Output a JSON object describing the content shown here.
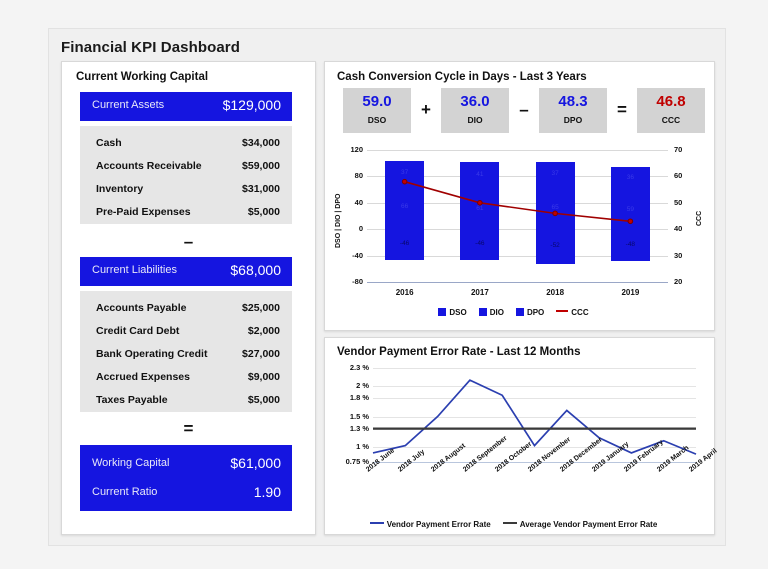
{
  "dashboard": {
    "title": "Financial KPI Dashboard"
  },
  "working_capital": {
    "panel_title": "Current Working Capital",
    "assets_header": {
      "label": "Current Assets",
      "value": "$129,000"
    },
    "assets_rows": [
      {
        "name": "Cash",
        "value": "$34,000"
      },
      {
        "name": "Accounts Receivable",
        "value": "$59,000"
      },
      {
        "name": "Inventory",
        "value": "$31,000"
      },
      {
        "name": "Pre-Paid Expenses",
        "value": "$5,000"
      }
    ],
    "operator_minus": "–",
    "liabilities_header": {
      "label": "Current Liabilities",
      "value": "$68,000"
    },
    "liabilities_rows": [
      {
        "name": "Accounts Payable",
        "value": "$25,000"
      },
      {
        "name": "Credit Card Debt",
        "value": "$2,000"
      },
      {
        "name": "Bank Operating Credit",
        "value": "$27,000"
      },
      {
        "name": "Accrued Expenses",
        "value": "$9,000"
      },
      {
        "name": "Taxes Payable",
        "value": "$5,000"
      }
    ],
    "operator_equals": "=",
    "result_rows": [
      {
        "name": "Working Capital",
        "value": "$61,000"
      },
      {
        "name": "Current Ratio",
        "value": "1.90"
      }
    ]
  },
  "ccc": {
    "panel_title": "Cash Conversion Cycle in Days - Last 3 Years",
    "kpis": [
      {
        "value": "59.0",
        "caption": "DSO",
        "color": "#1515e0"
      },
      {
        "value": "36.0",
        "caption": "DIO",
        "color": "#1515e0"
      },
      {
        "value": "48.3",
        "caption": "DPO",
        "color": "#1515e0"
      },
      {
        "value": "46.8",
        "caption": "CCC",
        "color": "#c00000"
      }
    ],
    "operators": {
      "plus": "+",
      "minus": "–",
      "equals": "="
    },
    "chart_data": {
      "type": "bar",
      "title": "Cash Conversion Cycle in Days - Last 3 Years",
      "categories": [
        "2016",
        "2017",
        "2018",
        "2019"
      ],
      "series": [
        {
          "name": "DSO",
          "values": [
            66,
            61,
            65,
            59
          ]
        },
        {
          "name": "DIO",
          "values": [
            37,
            41,
            37,
            36
          ]
        },
        {
          "name": "DPO",
          "values": [
            -46,
            -46,
            -52,
            -48
          ]
        },
        {
          "name": "CCC",
          "values": [
            58,
            50,
            46,
            43
          ],
          "axis": "right",
          "type": "line",
          "color": "#a00000"
        }
      ],
      "ylabel": "DSO | DIO | DPO",
      "ylim": [
        -80,
        120
      ],
      "yticks": [
        "-80",
        "-40",
        "0",
        "40",
        "80",
        "120"
      ],
      "y2label": "CCC",
      "y2lim": [
        20,
        70
      ],
      "y2ticks": [
        "20",
        "30",
        "40",
        "50",
        "60",
        "70"
      ],
      "xlabel": "",
      "grid": true,
      "legend": [
        "DSO",
        "DIO",
        "DPO",
        "CCC"
      ],
      "legend_position": "bottom"
    }
  },
  "vendor": {
    "panel_title": "Vendor Payment Error Rate - Last 12 Months",
    "chart_data": {
      "type": "line",
      "title": "Vendor Payment Error Rate - Last 12 Months",
      "categories": [
        "2018 June",
        "2018 July",
        "2018 August",
        "2018 September",
        "2018 October",
        "2018 November",
        "2018 December",
        "2019 January",
        "2019 February",
        "2019 March",
        "2019 April"
      ],
      "series": [
        {
          "name": "Vendor Payment Error Rate",
          "values": [
            0.9,
            1.02,
            1.5,
            2.1,
            1.85,
            1.02,
            1.6,
            1.15,
            0.9,
            1.1,
            0.88
          ],
          "color": "#2b3fb0"
        },
        {
          "name": "Average Vendor Payment Error Rate",
          "values": [
            1.3,
            1.3,
            1.3,
            1.3,
            1.3,
            1.3,
            1.3,
            1.3,
            1.3,
            1.3,
            1.3
          ],
          "color": "#3a3a3a"
        }
      ],
      "ylabel": "",
      "yticks": [
        "0.75 %",
        "1 %",
        "1.3 %",
        "1.5 %",
        "1.8 %",
        "2 %",
        "2.3 %"
      ],
      "ylim": [
        0.75,
        2.3
      ],
      "grid": true,
      "legend": [
        "Vendor Payment Error Rate",
        "Average Vendor Payment Error Rate"
      ],
      "legend_position": "bottom"
    }
  }
}
